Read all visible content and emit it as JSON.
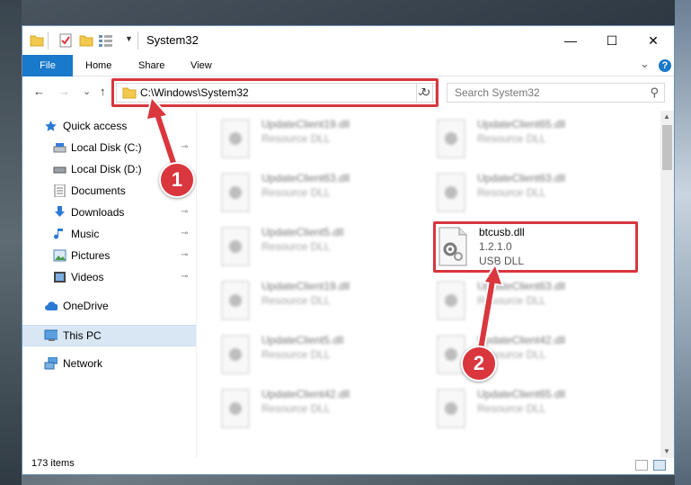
{
  "window": {
    "title": "System32",
    "minimize": "—",
    "maximize": "☐",
    "close": "✕"
  },
  "ribbon": {
    "tabs": [
      {
        "label": "File"
      },
      {
        "label": "Home"
      },
      {
        "label": "Share"
      },
      {
        "label": "View"
      }
    ],
    "expand": "⌄",
    "help": "?"
  },
  "address": {
    "path": "C:\\Windows\\System32",
    "dropdown": "⌄",
    "refresh": "↻"
  },
  "search": {
    "placeholder": "Search System32",
    "icon": "⚲"
  },
  "nav": {
    "back": "←",
    "forward": "→",
    "recent": "⌄",
    "up": "↑"
  },
  "sidebar": {
    "quick_access": "Quick access",
    "items": [
      {
        "label": "Local Disk (C:)",
        "pinned": true
      },
      {
        "label": "Local Disk (D:)",
        "pinned": false
      },
      {
        "label": "Documents",
        "pinned": true
      },
      {
        "label": "Downloads",
        "pinned": true
      },
      {
        "label": "Music",
        "pinned": true
      },
      {
        "label": "Pictures",
        "pinned": true
      },
      {
        "label": "Videos",
        "pinned": true
      }
    ],
    "onedrive": "OneDrive",
    "this_pc": "This PC",
    "network": "Network",
    "pin_glyph": "📌"
  },
  "files": {
    "left": [
      {
        "name": "UpdateClient19.dll",
        "type": "Resource DLL"
      },
      {
        "name": "UpdateClient63.dll",
        "type": "Resource DLL"
      },
      {
        "name": "UpdateClient5.dll",
        "type": "Resource DLL"
      },
      {
        "name": "UpdateClient19.dll",
        "type": "Resource DLL"
      },
      {
        "name": "UpdateClient5.dll",
        "type": "Resource DLL"
      },
      {
        "name": "UpdateClient42.dll",
        "type": "Resource DLL"
      }
    ],
    "right": [
      {
        "name": "UpdateClient65.dll",
        "type": "Resource DLL"
      },
      {
        "name": "UpdateClient63.dll",
        "type": "Resource DLL"
      },
      {
        "name": "UpdateClient63.dll",
        "type": "Resource DLL"
      },
      {
        "name": "UpdateClient42.dll",
        "type": "Resource DLL"
      },
      {
        "name": "UpdateClient65.dll",
        "type": "Resource DLL"
      }
    ],
    "highlight": {
      "name": "btcusb.dll",
      "version": "1.2.1.0",
      "type": "USB DLL"
    }
  },
  "status": {
    "item_count": "173 items"
  },
  "callouts": {
    "one": "1",
    "two": "2"
  },
  "colors": {
    "accent": "#1979ca",
    "callout": "#d9363e"
  }
}
